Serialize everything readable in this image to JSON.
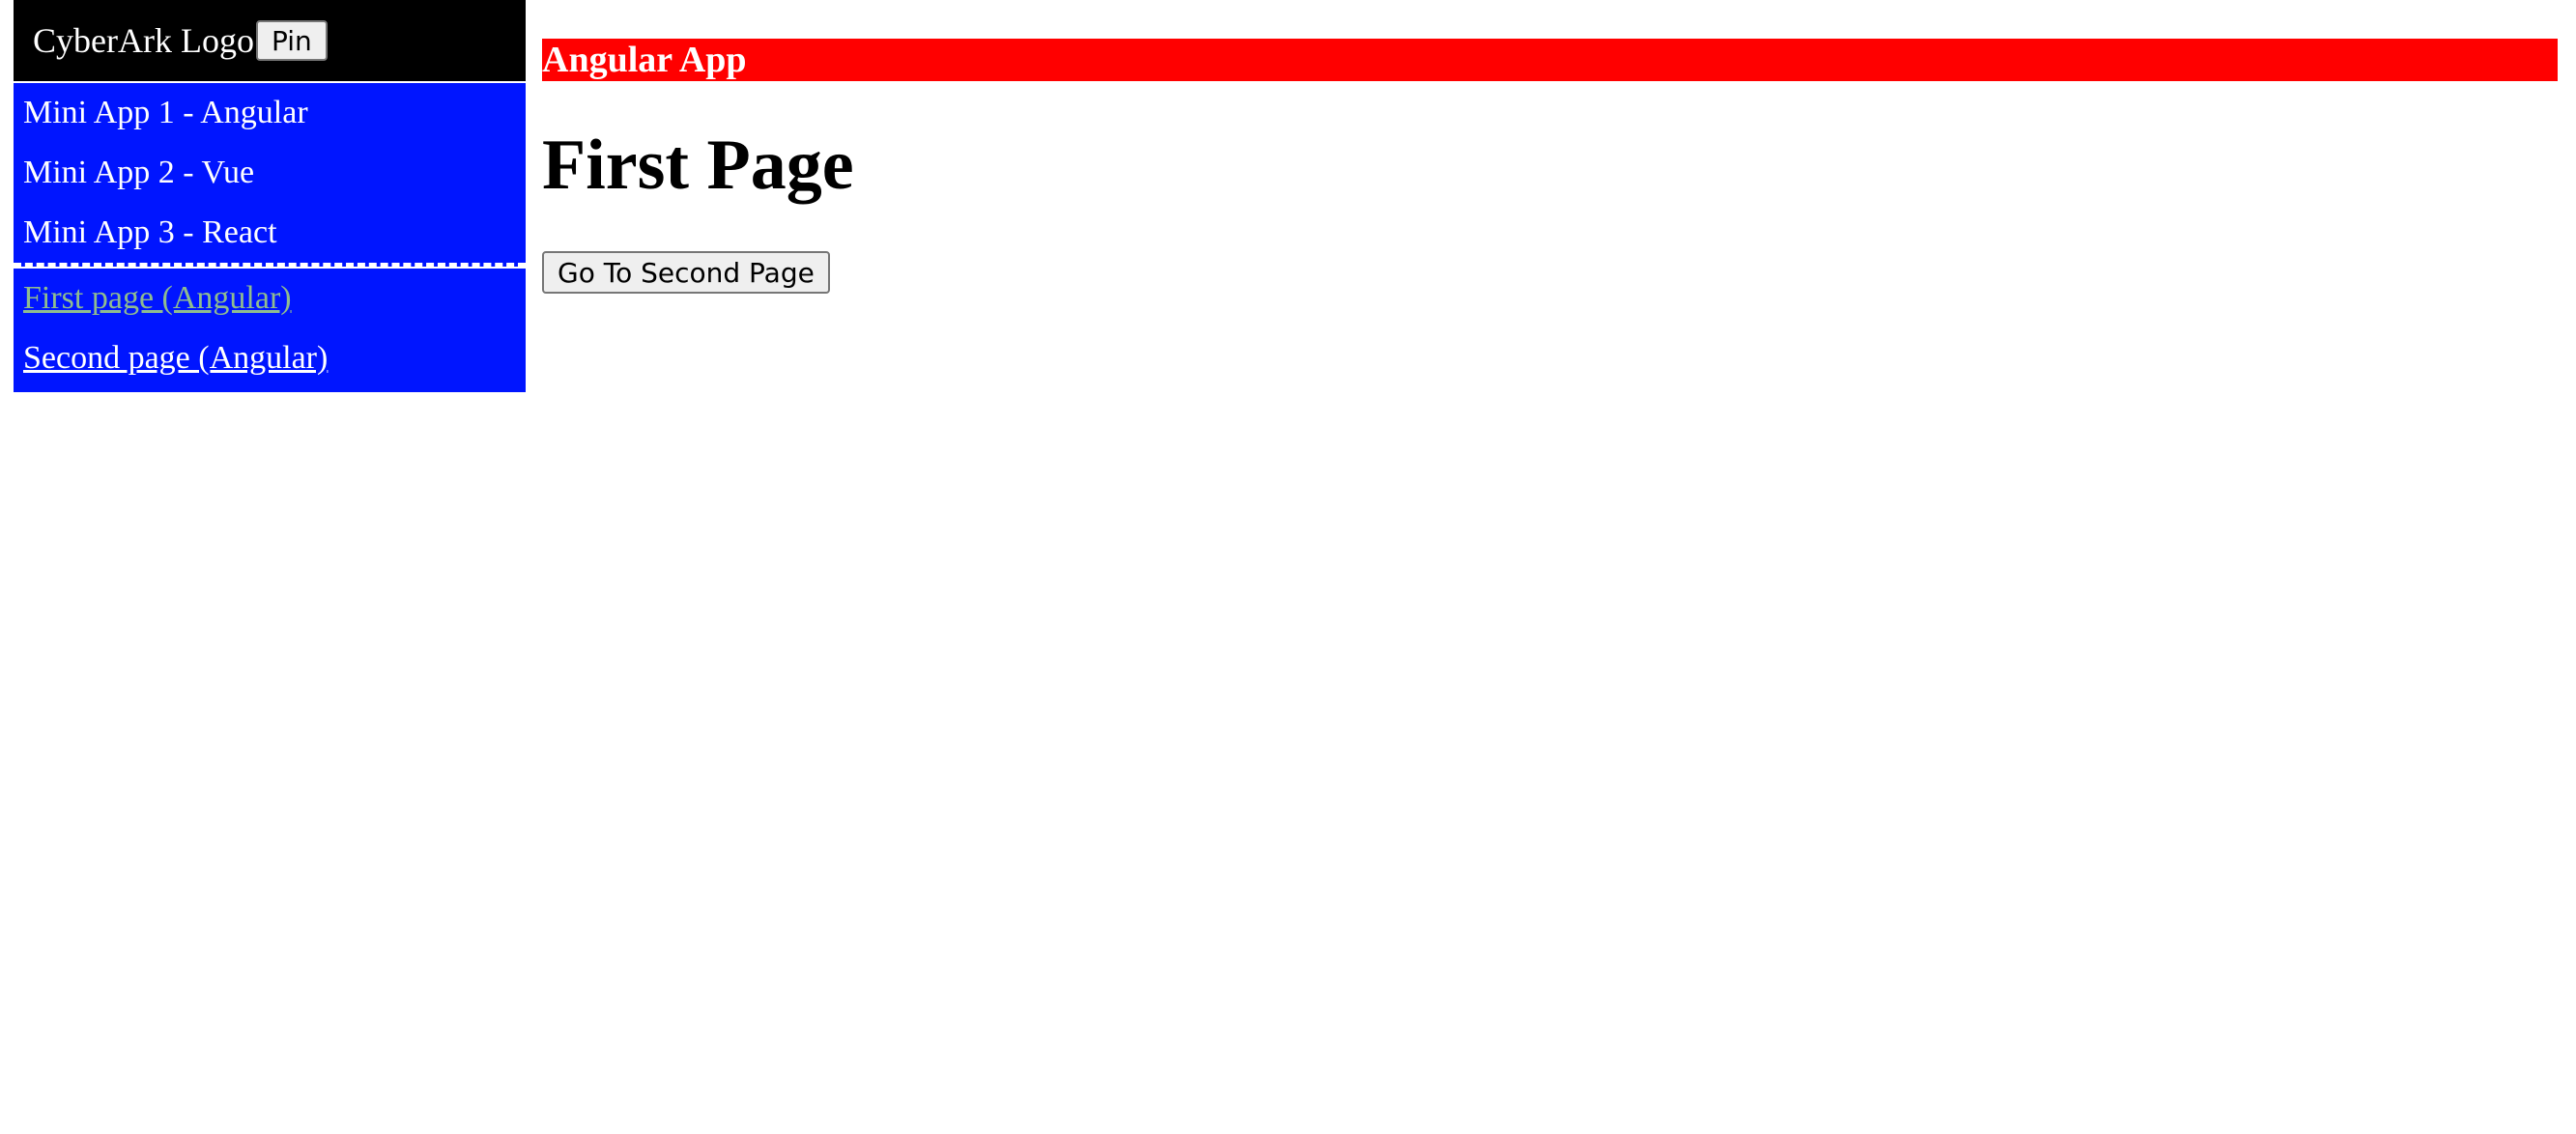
{
  "sidebar": {
    "logo_text": "CyberArk Logo",
    "pin_label": "Pin",
    "apps": [
      {
        "label": "Mini App 1 - Angular"
      },
      {
        "label": "Mini App 2 - Vue"
      },
      {
        "label": "Mini App 3 - React"
      }
    ],
    "pages": [
      {
        "label": "First page (Angular)"
      },
      {
        "label": "Second page (Angular)"
      }
    ]
  },
  "main": {
    "banner_title": "Angular App",
    "page_title": "First Page",
    "go_button_label": "Go To Second Page"
  },
  "colors": {
    "header_bg": "#000000",
    "sidebar_bg": "#0015ff",
    "banner_bg": "#ff0000",
    "visited_link": "#8fbc8f"
  }
}
